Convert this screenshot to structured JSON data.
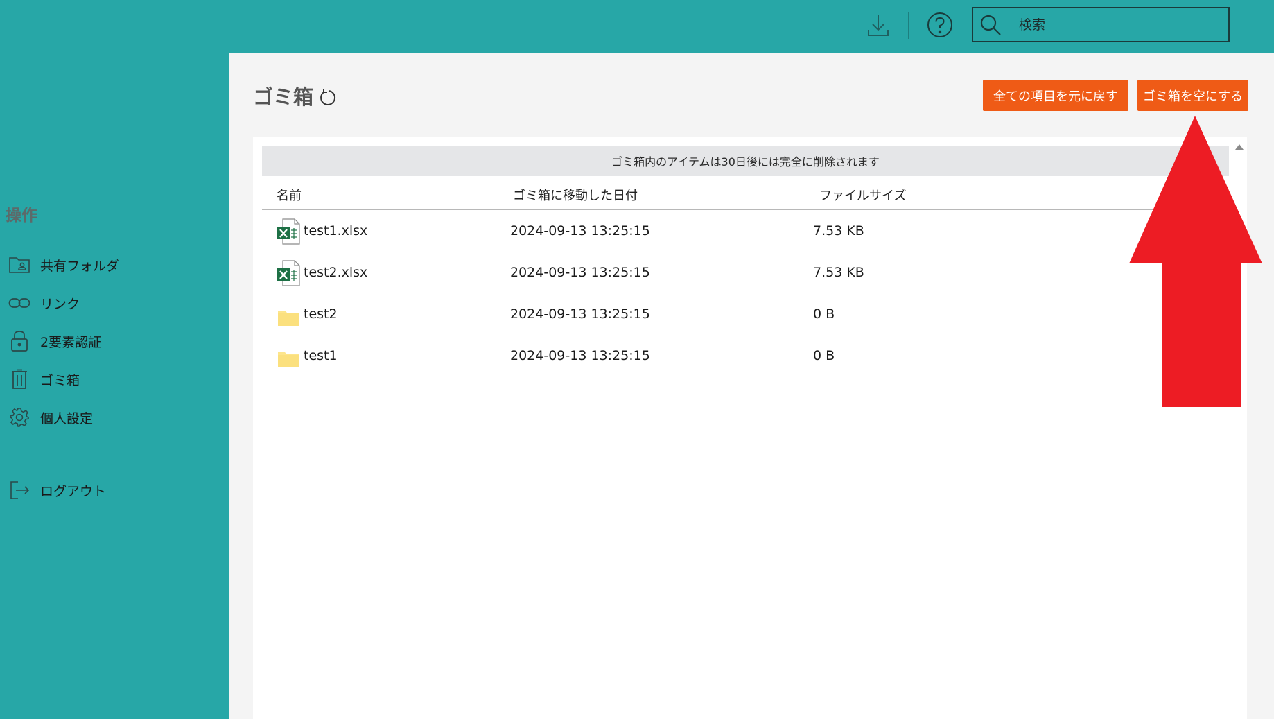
{
  "topbar": {
    "download_icon": "download-icon",
    "help_icon": "help-icon",
    "search": {
      "placeholder": "検索",
      "value": ""
    }
  },
  "sidebar": {
    "heading": "操作",
    "items": [
      {
        "label": "共有フォルダ",
        "icon": "shared-folder-icon"
      },
      {
        "label": "リンク",
        "icon": "link-icon"
      },
      {
        "label": "2要素認証",
        "icon": "lock-icon"
      },
      {
        "label": "ゴミ箱",
        "icon": "trash-icon"
      },
      {
        "label": "個人設定",
        "icon": "gear-icon"
      },
      {
        "label": "ログアウト",
        "icon": "logout-icon"
      }
    ]
  },
  "main": {
    "title": "ゴミ箱",
    "restore_all_label": "全ての項目を元に戻す",
    "empty_trash_label": "ゴミ箱を空にする",
    "notice": "ゴミ箱内のアイテムは30日後には完全に削除されます",
    "columns": {
      "name": "名前",
      "moved_date": "ゴミ箱に移動した日付",
      "size": "ファイルサイズ"
    },
    "rows": [
      {
        "name": "test1.xlsx",
        "date": "2024-09-13 13:25:15",
        "size": "7.53 KB",
        "type": "excel"
      },
      {
        "name": "test2.xlsx",
        "date": "2024-09-13 13:25:15",
        "size": "7.53 KB",
        "type": "excel"
      },
      {
        "name": "test2",
        "date": "2024-09-13 13:25:15",
        "size": "0 B",
        "type": "folder"
      },
      {
        "name": "test1",
        "date": "2024-09-13 13:25:15",
        "size": "0 B",
        "type": "folder"
      }
    ]
  },
  "colors": {
    "teal": "#27a7a7",
    "button_orange": "#ef5b16",
    "arrow_red": "#ed1c24",
    "excel_green": "#1d7045",
    "folder_yellow": "#fde58c"
  }
}
